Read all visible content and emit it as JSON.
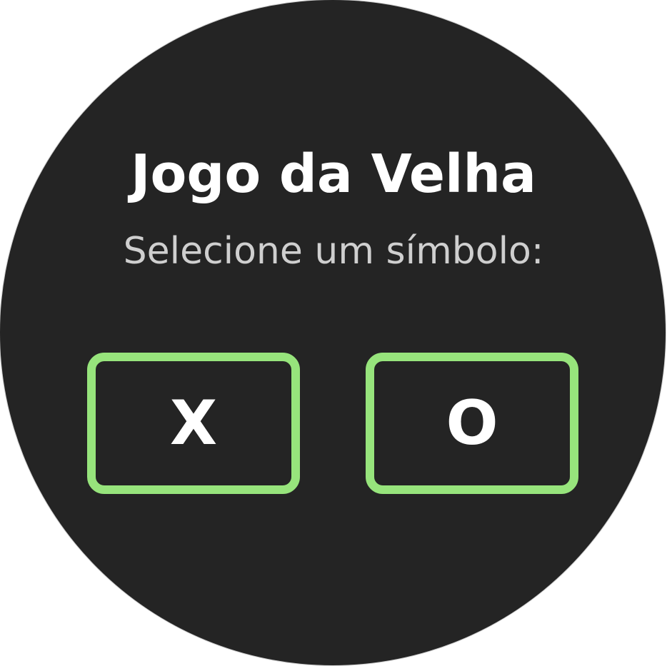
{
  "app": {
    "title": "Jogo da Velha",
    "prompt": "Selecione um símbolo:"
  },
  "symbols": [
    {
      "label": "X"
    },
    {
      "label": "O"
    }
  ],
  "colors": {
    "background": "#242424",
    "accent": "#97e47c",
    "title_text": "#ffffff",
    "subtitle_text": "#cfcfcf"
  }
}
